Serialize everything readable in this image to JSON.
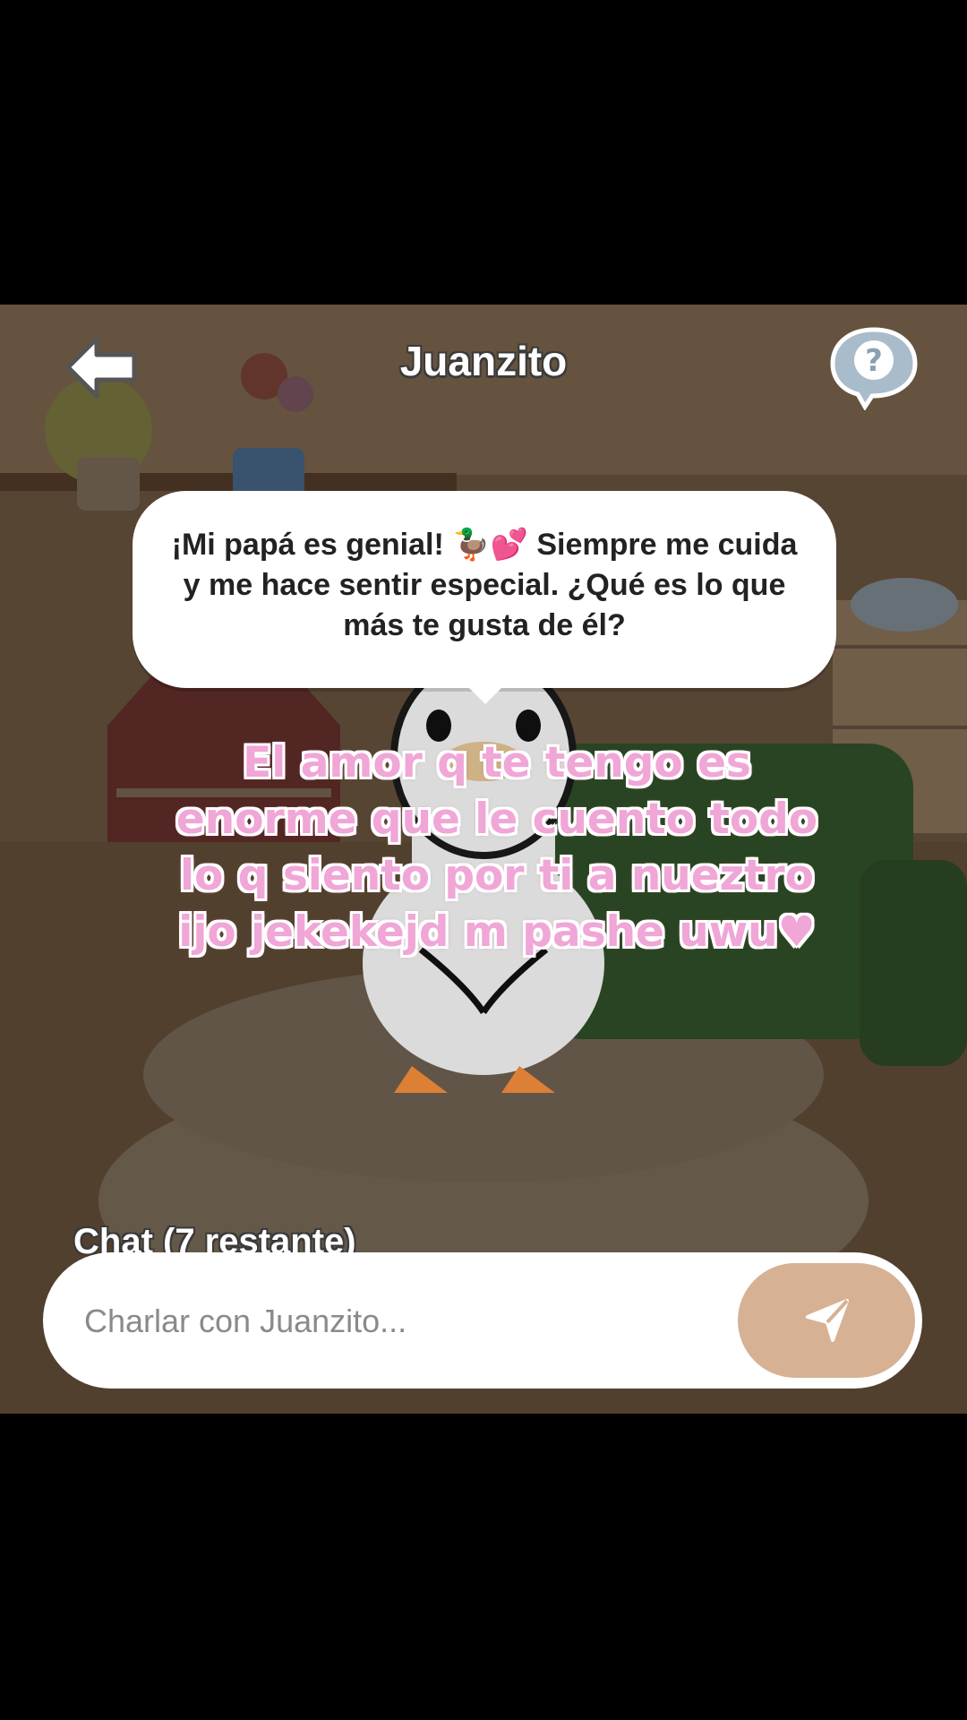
{
  "header": {
    "title": "Juanzito",
    "back_icon": "back-arrow-icon",
    "help_icon": "help-question-icon"
  },
  "character_message": "¡Mi papá es genial! 🦆💕 Siempre me cuida y me hace sentir especial. ¿Qué es lo que más te gusta de él?",
  "overlay_caption": "El amor q te tengo es enorme que le cuento todo lo q siento por ti a nueztro ijo jekekejd m pashe uwu♥",
  "chat": {
    "label": "Chat (7 restante)",
    "placeholder": "Charlar con Juanzito...",
    "send_icon": "send-paper-plane-icon"
  },
  "colors": {
    "send_button": "#d6b194",
    "caption_pink": "#f0a6d6"
  }
}
